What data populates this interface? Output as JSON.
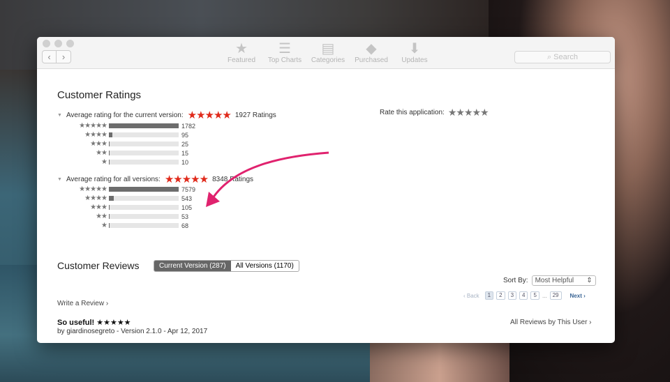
{
  "toolbar": {
    "back": "‹",
    "forward": "›",
    "items": [
      {
        "label": "Featured",
        "icon": "★"
      },
      {
        "label": "Top Charts",
        "icon": "☰"
      },
      {
        "label": "Categories",
        "icon": "▤"
      },
      {
        "label": "Purchased",
        "icon": "◆"
      },
      {
        "label": "Updates",
        "icon": "⬇"
      }
    ],
    "search_placeholder": "Search"
  },
  "ratings": {
    "title": "Customer Ratings",
    "current": {
      "label": "Average rating for the current version:",
      "stars": "★★★★★",
      "total": "1927 Ratings",
      "rows": [
        {
          "stars": "★★★★★",
          "count": "1782",
          "value": 1782
        },
        {
          "stars": "★★★★",
          "count": "95",
          "value": 95
        },
        {
          "stars": "★★★",
          "count": "25",
          "value": 25
        },
        {
          "stars": "★★",
          "count": "15",
          "value": 15
        },
        {
          "stars": "★",
          "count": "10",
          "value": 10
        }
      ]
    },
    "all": {
      "label": "Average rating for all versions:",
      "stars": "★★★★★",
      "total": "8348 Ratings",
      "rows": [
        {
          "stars": "★★★★★",
          "count": "7579",
          "value": 7579
        },
        {
          "stars": "★★★★",
          "count": "543",
          "value": 543
        },
        {
          "stars": "★★★",
          "count": "105",
          "value": 105
        },
        {
          "stars": "★★",
          "count": "53",
          "value": 53
        },
        {
          "stars": "★",
          "count": "68",
          "value": 68
        }
      ]
    },
    "rate_label": "Rate this application:",
    "rate_stars": "★★★★★"
  },
  "reviews": {
    "title": "Customer Reviews",
    "tabs": [
      "Current Version (287)",
      "All Versions (1170)"
    ],
    "sort_label": "Sort By:",
    "sort_value": "Most Helpful",
    "back": "‹ Back",
    "pages": [
      "1",
      "2",
      "3",
      "4",
      "5"
    ],
    "ellipsis": "...",
    "last_page": "29",
    "next": "Next ›",
    "write": "Write a Review ›",
    "all_by_user": "All Reviews by This User ›",
    "item": {
      "title": "So useful!",
      "stars": "★★★★★",
      "meta": "by giardinosegreto - Version 2.1.0 - Apr 12, 2017"
    }
  },
  "colors": {
    "star_red": "#e0291a",
    "arrow": "#e0226e"
  }
}
